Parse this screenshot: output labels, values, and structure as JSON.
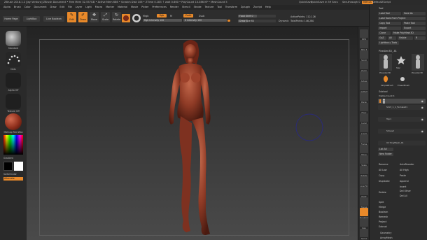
{
  "titlebar": {
    "title": "ZBrush 2018.1.2 [Jay Ventura]    ZBrush Document    • Free Mem 32.557GB • Active Mem 686 • Scratch Disk 106 • ZTime 0.183 ↑ wait 0.660 • PolyCount 10.086 KP • MeshCount 5",
    "quicksave": "QuickSave in 59 Secs",
    "quicksave_btn": "QuickSave",
    "seethrough": "See-through 0",
    "menus": "Menus",
    "defaultzscript": "DefaultZScript"
  },
  "menubar": [
    "Alpha",
    "Brush",
    "Color",
    "Document",
    "Draw",
    "Edit",
    "File",
    "Layer",
    "Light",
    "Macro",
    "Marker",
    "Material",
    "Movie",
    "Picker",
    "Preferences",
    "Render",
    "Stencil",
    "Stroke",
    "Texture",
    "Tool",
    "Transform",
    "Zplugin",
    "Zscript",
    "Help"
  ],
  "toolbar": {
    "home_page": "Home Page",
    "lightbox": "LightBox",
    "live_boolean": "Live Boolean",
    "edit": "Edit",
    "draw": "Draw",
    "move": "Move",
    "scale": "Scale",
    "rotate": "Rotate",
    "mrgb": "Mrgb",
    "rgb": "Rgb",
    "m": "M",
    "rgb_intensity": "Rgb Intensity 100",
    "zadd": "Zadd",
    "zsub": "Zsub",
    "zintensity": "Z Intensity 100",
    "focal_shift": "Focal Shift 0",
    "draw_size": "Draw Size 64",
    "dynamic": "Dynamic",
    "active_points": "ActivePoints: 112,126",
    "total_points": "TotalPoints: 146,280"
  },
  "leftpanel": {
    "brush": "Standard",
    "stroke": "Dots",
    "alpha": "Alpha Off",
    "texture": "Texture Off",
    "material": "MatCap Red Wax",
    "gradient": "Gradient",
    "switch_color": "SwitchColor",
    "alternate": "Alternate"
  },
  "shelf": [
    "BPR",
    "SPix 3",
    "Scroll",
    "Zoom",
    "Actual",
    "AAHalf",
    "Persp",
    "Floor",
    "Local",
    "L.Sym",
    "Frame",
    "Move",
    "Scale",
    "Rotate",
    "Line Fill",
    "PolyF",
    "Transp",
    "Dynamic",
    "Solo",
    "Xpose"
  ],
  "palette": {
    "header": "Tool",
    "load_tool": "Load Tool",
    "save_as": "Save As",
    "load_tools_from_project": "Load Tools From Project",
    "copy_tool": "Copy Tool",
    "paste_tool": "Paste Tool",
    "import": "Import",
    "export": "Export",
    "clone": "Clone",
    "make_polymesh3d": "Make PolyMesh3D",
    "goz": "GoZ",
    "all": "All",
    "visible": "Visible",
    "r": "R",
    "lightbox_tools": "Lightbox ▸ Tools",
    "current_tool": "PineAlen3D_-81",
    "tools": [
      "PineAlen3D",
      "Star",
      "PineAlen3D",
      "SimpleBrush",
      "EraserBrush",
      "PineAlen3D"
    ],
    "subtool": "Subtool",
    "visible_count": "Visible Count 4",
    "subtools": [
      "",
      "Shirt_1_1_Female01",
      "Top1",
      "Shoes2",
      "UV PolyMesh_01"
    ],
    "list_all": "List All",
    "new_folder": "New Folder",
    "rename": "Rename",
    "autoreorder": "AutoReorder",
    "all_low": "All Low",
    "all_high": "All High",
    "copy": "Copy",
    "paste": "Paste",
    "duplicate": "Duplicate",
    "append": "Append",
    "insert": "Insert",
    "delete": "Delete",
    "del_other": "Del Other",
    "del_all": "Del All",
    "split": "Split",
    "merge": "Merge",
    "boolean": "Boolean",
    "remesh": "Remesh",
    "project": "Project",
    "extract": "Extract",
    "geometry": "Geometry",
    "arraymesh": "ArrayMesh"
  },
  "colors": {
    "accent": "#e8892a",
    "wax": "#9c3a24",
    "panel": "#2c2c2c"
  }
}
